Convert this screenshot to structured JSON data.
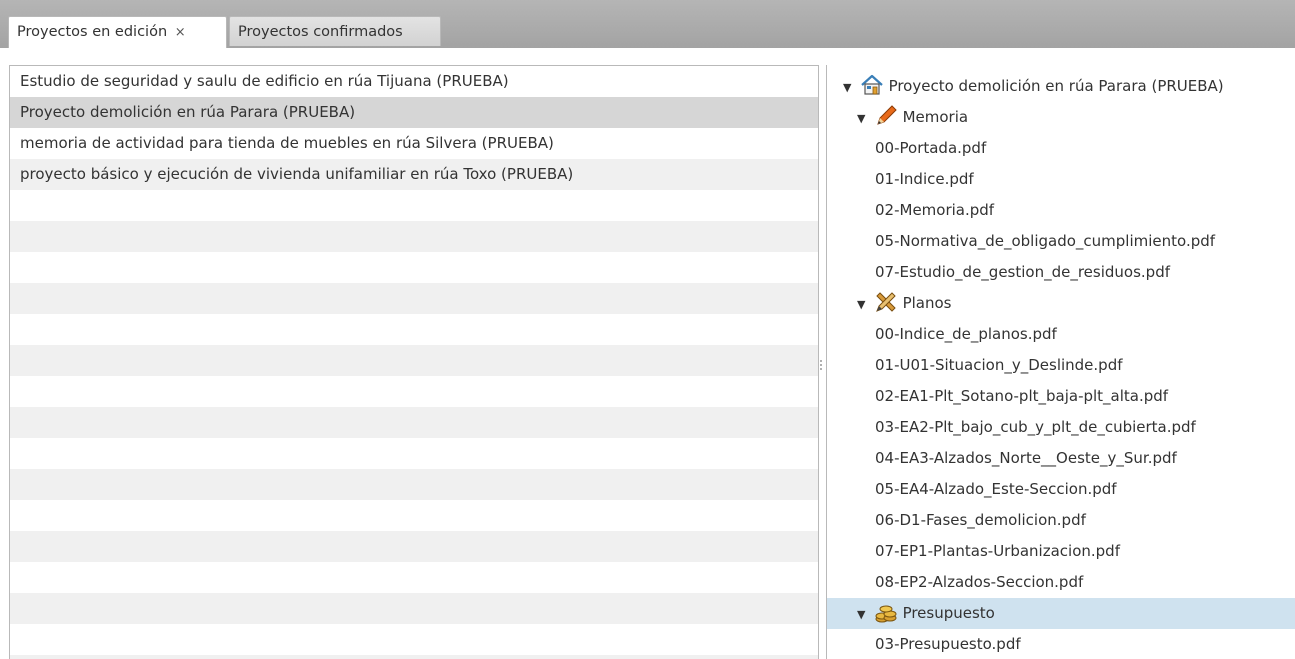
{
  "tabs": {
    "active_label": "Proyectos en edición",
    "close_glyph": "×",
    "inactive_label": "Proyectos confirmados"
  },
  "projects": [
    "Estudio de seguridad y saulu de edificio en rúa Tijuana (PRUEBA)",
    "Proyecto demolición en rúa Parara (PRUEBA)",
    "memoria de actividad para tienda de muebles en rúa Silvera (PRUEBA)",
    "proyecto básico y ejecución de vivienda unifamiliar en rúa Toxo (PRUEBA)"
  ],
  "tree": {
    "expand_glyph": "▼",
    "root": {
      "label": "Proyecto demolición en rúa Parara (PRUEBA)",
      "icon": "house-icon"
    },
    "memoria": {
      "label": "Memoria",
      "icon": "pencil-icon",
      "files": [
        "00-Portada.pdf",
        "01-Indice.pdf",
        "02-Memoria.pdf",
        "05-Normativa_de_obligado_cumplimiento.pdf",
        "07-Estudio_de_gestion_de_residuos.pdf"
      ]
    },
    "planos": {
      "label": "Planos",
      "icon": "ruler-pencil-cross-icon",
      "files": [
        "00-Indice_de_planos.pdf",
        "01-U01-Situacion_y_Deslinde.pdf",
        "02-EA1-Plt_Sotano-plt_baja-plt_alta.pdf",
        "03-EA2-Plt_bajo_cub_y_plt_de_cubierta.pdf",
        "04-EA3-Alzados_Norte__Oeste_y_Sur.pdf",
        "05-EA4-Alzado_Este-Seccion.pdf",
        "06-D1-Fases_demolicion.pdf",
        "07-EP1-Plantas-Urbanizacion.pdf",
        "08-EP2-Alzados-Seccion.pdf"
      ]
    },
    "presupuesto": {
      "label": "Presupuesto",
      "icon": "coins-icon",
      "files": [
        "03-Presupuesto.pdf"
      ]
    }
  },
  "colors": {
    "selected_tree_row": "#cfe2ef",
    "selected_list_row": "#d6d6d6"
  }
}
